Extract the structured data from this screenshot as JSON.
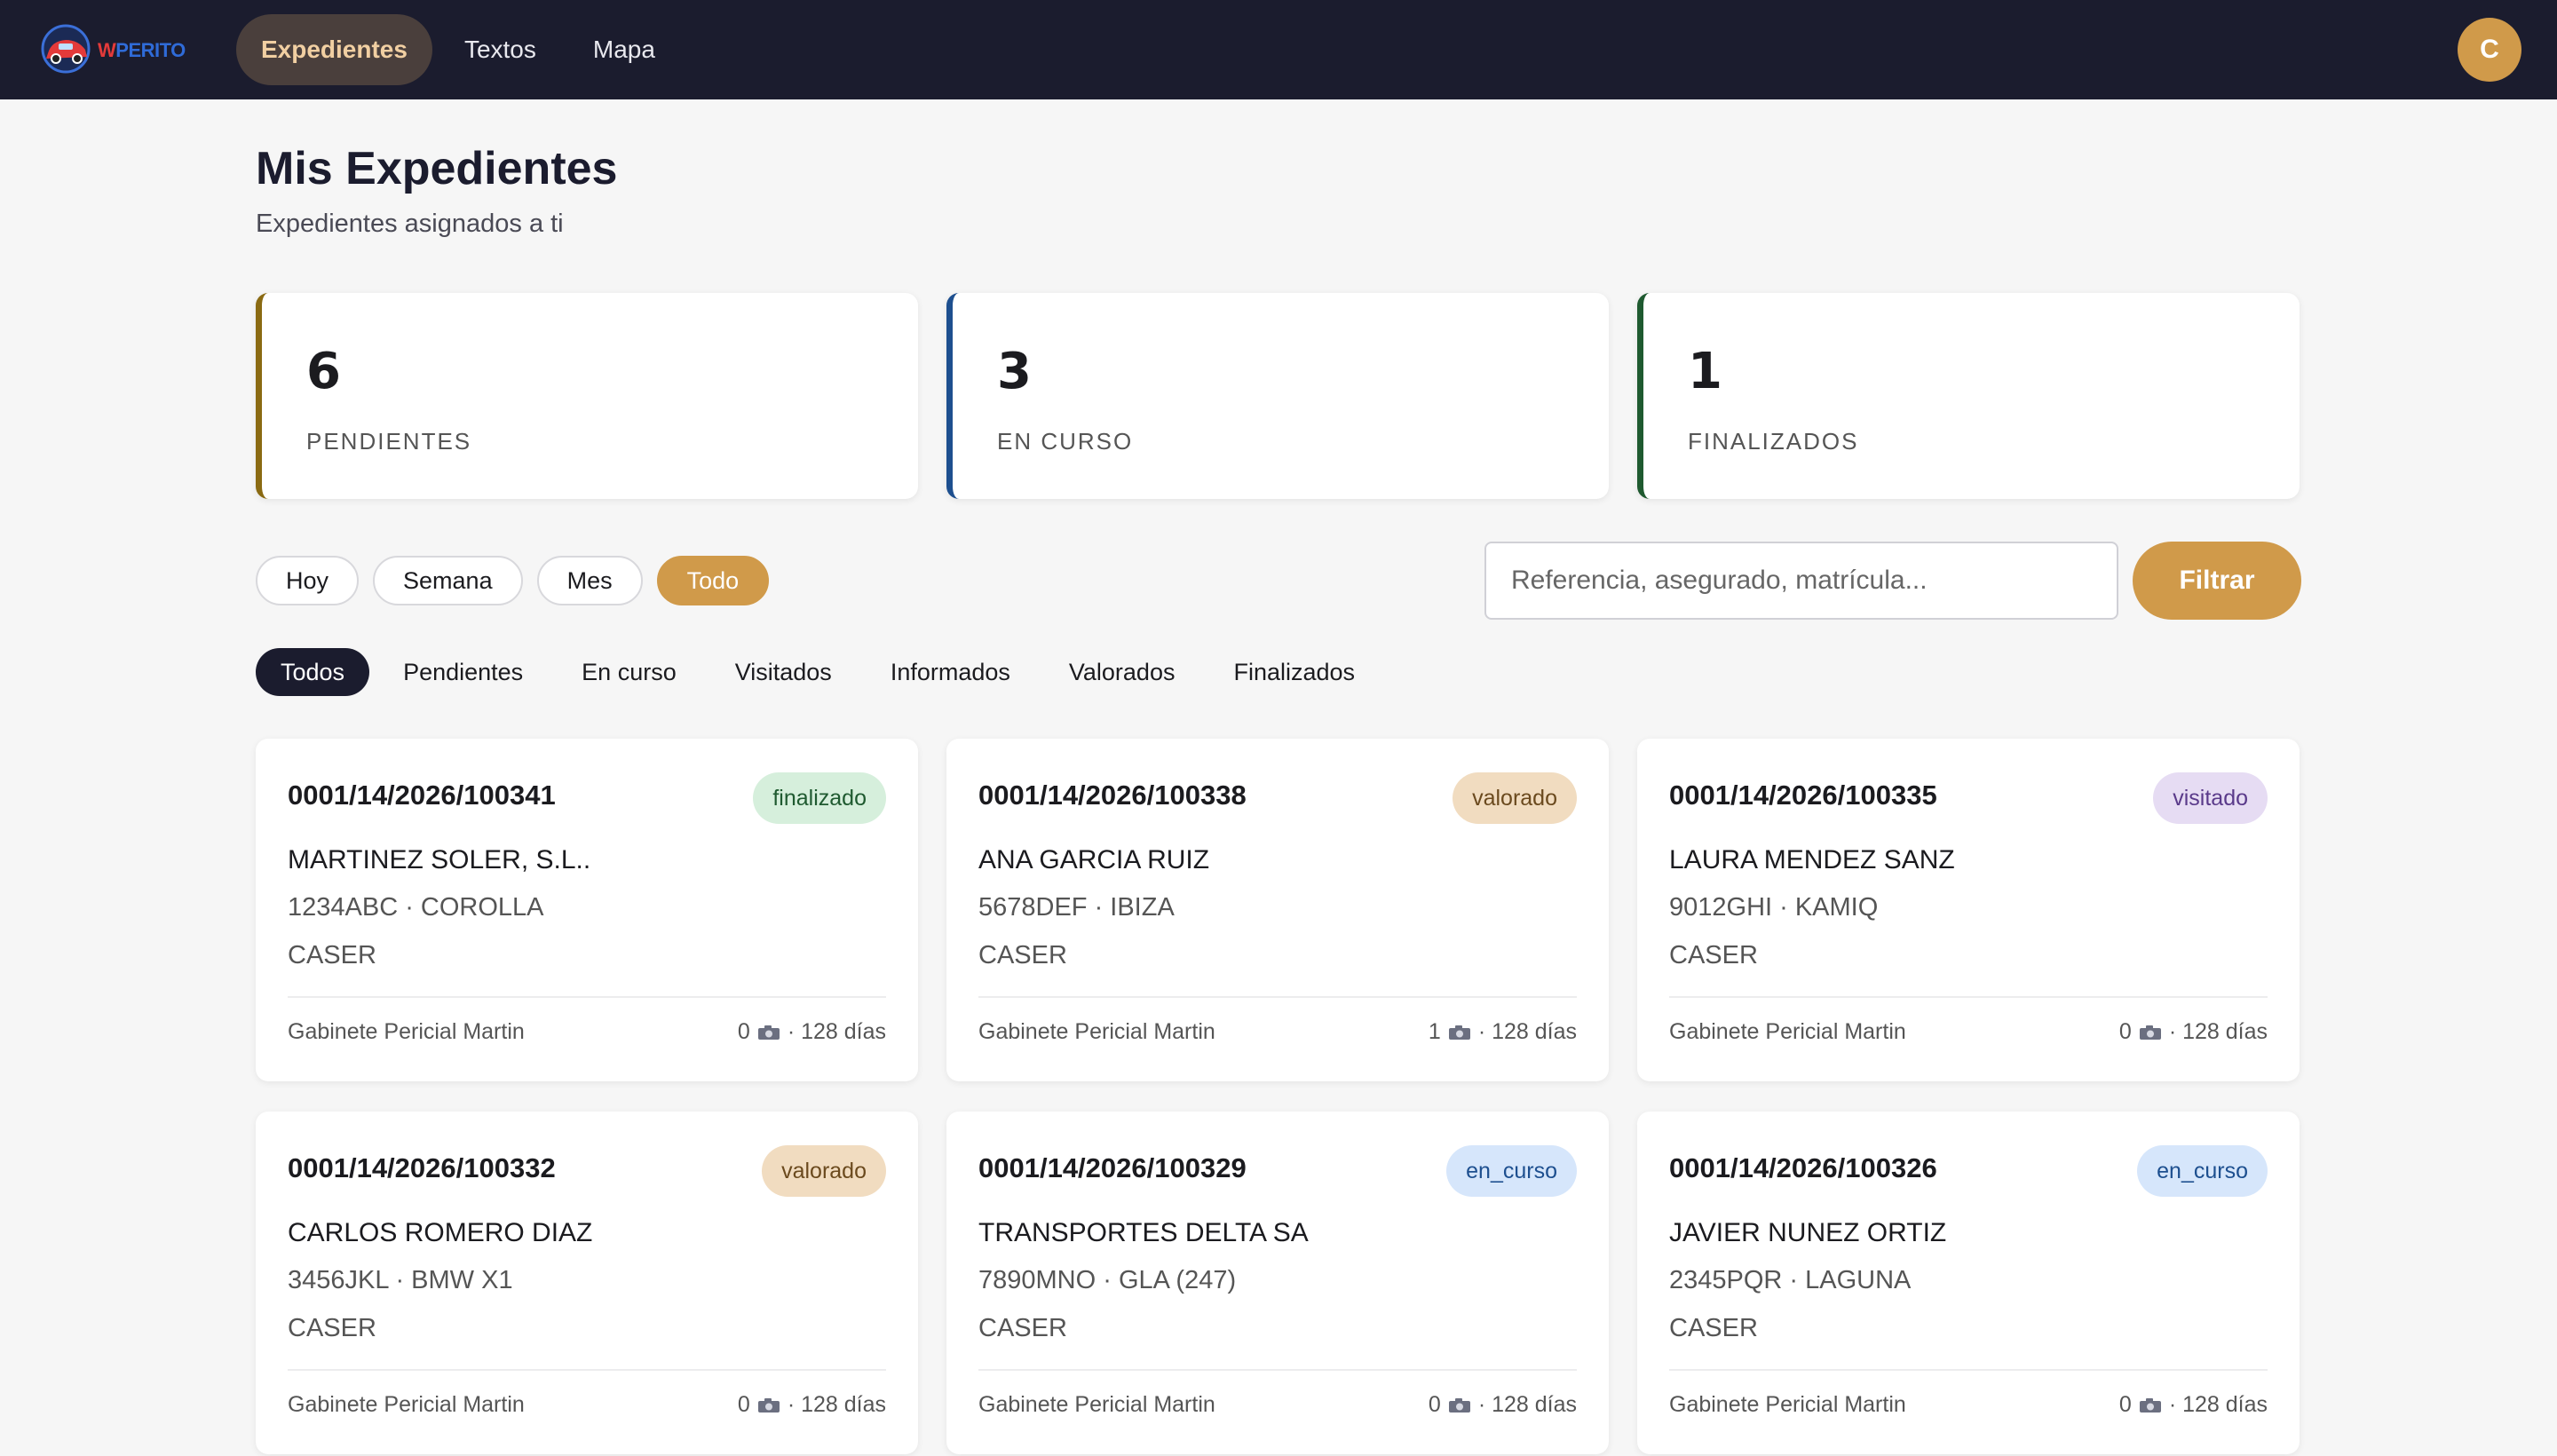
{
  "app": {
    "logo_text": "WPERITO",
    "avatar_initial": "C"
  },
  "nav": {
    "tabs": [
      {
        "label": "Expedientes",
        "active": true
      },
      {
        "label": "Textos",
        "active": false
      },
      {
        "label": "Mapa",
        "active": false
      }
    ]
  },
  "header": {
    "title": "Mis Expedientes",
    "subtitle": "Expedientes asignados a ti"
  },
  "stats": [
    {
      "value": "6",
      "label": "PENDIENTES",
      "accent": "#8a6a12"
    },
    {
      "value": "3",
      "label": "EN CURSO",
      "accent": "#1d4f8f"
    },
    {
      "value": "1",
      "label": "FINALIZADOS",
      "accent": "#1f5a30"
    }
  ],
  "period_filters": [
    {
      "label": "Hoy",
      "active": false
    },
    {
      "label": "Semana",
      "active": false
    },
    {
      "label": "Mes",
      "active": false
    },
    {
      "label": "Todo",
      "active": true
    }
  ],
  "search": {
    "placeholder": "Referencia, asegurado, matrícula...",
    "button_label": "Filtrar"
  },
  "status_tabs": [
    {
      "label": "Todos",
      "active": true
    },
    {
      "label": "Pendientes",
      "active": false
    },
    {
      "label": "En curso",
      "active": false
    },
    {
      "label": "Visitados",
      "active": false
    },
    {
      "label": "Informados",
      "active": false
    },
    {
      "label": "Valorados",
      "active": false
    },
    {
      "label": "Finalizados",
      "active": false
    }
  ],
  "cases": [
    {
      "ref": "0001/14/2026/100341",
      "status": "finalizado",
      "name": "MARTINEZ SOLER, S.L..",
      "vehicle": "1234ABC · COROLLA",
      "insurer": "CASER",
      "firm": "Gabinete Pericial Martin",
      "photos": "0",
      "age": "· 128 días"
    },
    {
      "ref": "0001/14/2026/100338",
      "status": "valorado",
      "name": "ANA GARCIA RUIZ",
      "vehicle": "5678DEF · IBIZA",
      "insurer": "CASER",
      "firm": "Gabinete Pericial Martin",
      "photos": "1",
      "age": "· 128 días"
    },
    {
      "ref": "0001/14/2026/100335",
      "status": "visitado",
      "name": "LAURA MENDEZ SANZ",
      "vehicle": "9012GHI · KAMIQ",
      "insurer": "CASER",
      "firm": "Gabinete Pericial Martin",
      "photos": "0",
      "age": "· 128 días"
    },
    {
      "ref": "0001/14/2026/100332",
      "status": "valorado",
      "name": "CARLOS ROMERO DIAZ",
      "vehicle": "3456JKL · BMW X1",
      "insurer": "CASER",
      "firm": "Gabinete Pericial Martin",
      "photos": "0",
      "age": "· 128 días"
    },
    {
      "ref": "0001/14/2026/100329",
      "status": "en_curso",
      "name": "TRANSPORTES DELTA SA",
      "vehicle": "7890MNO · GLA (247)",
      "insurer": "CASER",
      "firm": "Gabinete Pericial Martin",
      "photos": "0",
      "age": "· 128 días"
    },
    {
      "ref": "0001/14/2026/100326",
      "status": "en_curso",
      "name": "JAVIER NUNEZ ORTIZ",
      "vehicle": "2345PQR · LAGUNA",
      "insurer": "CASER",
      "firm": "Gabinete Pericial Martin",
      "photos": "0",
      "age": "· 128 días"
    }
  ],
  "status_colors": {
    "finalizado": {
      "bg": "#d6efdc",
      "fg": "#1f5a30"
    },
    "valorado": {
      "bg": "#f1dcc0",
      "fg": "#6b4a1e"
    },
    "visitado": {
      "bg": "#e6dcf3",
      "fg": "#5a3a8a"
    },
    "en_curso": {
      "bg": "#d6e6fb",
      "fg": "#1d4f8f"
    }
  }
}
